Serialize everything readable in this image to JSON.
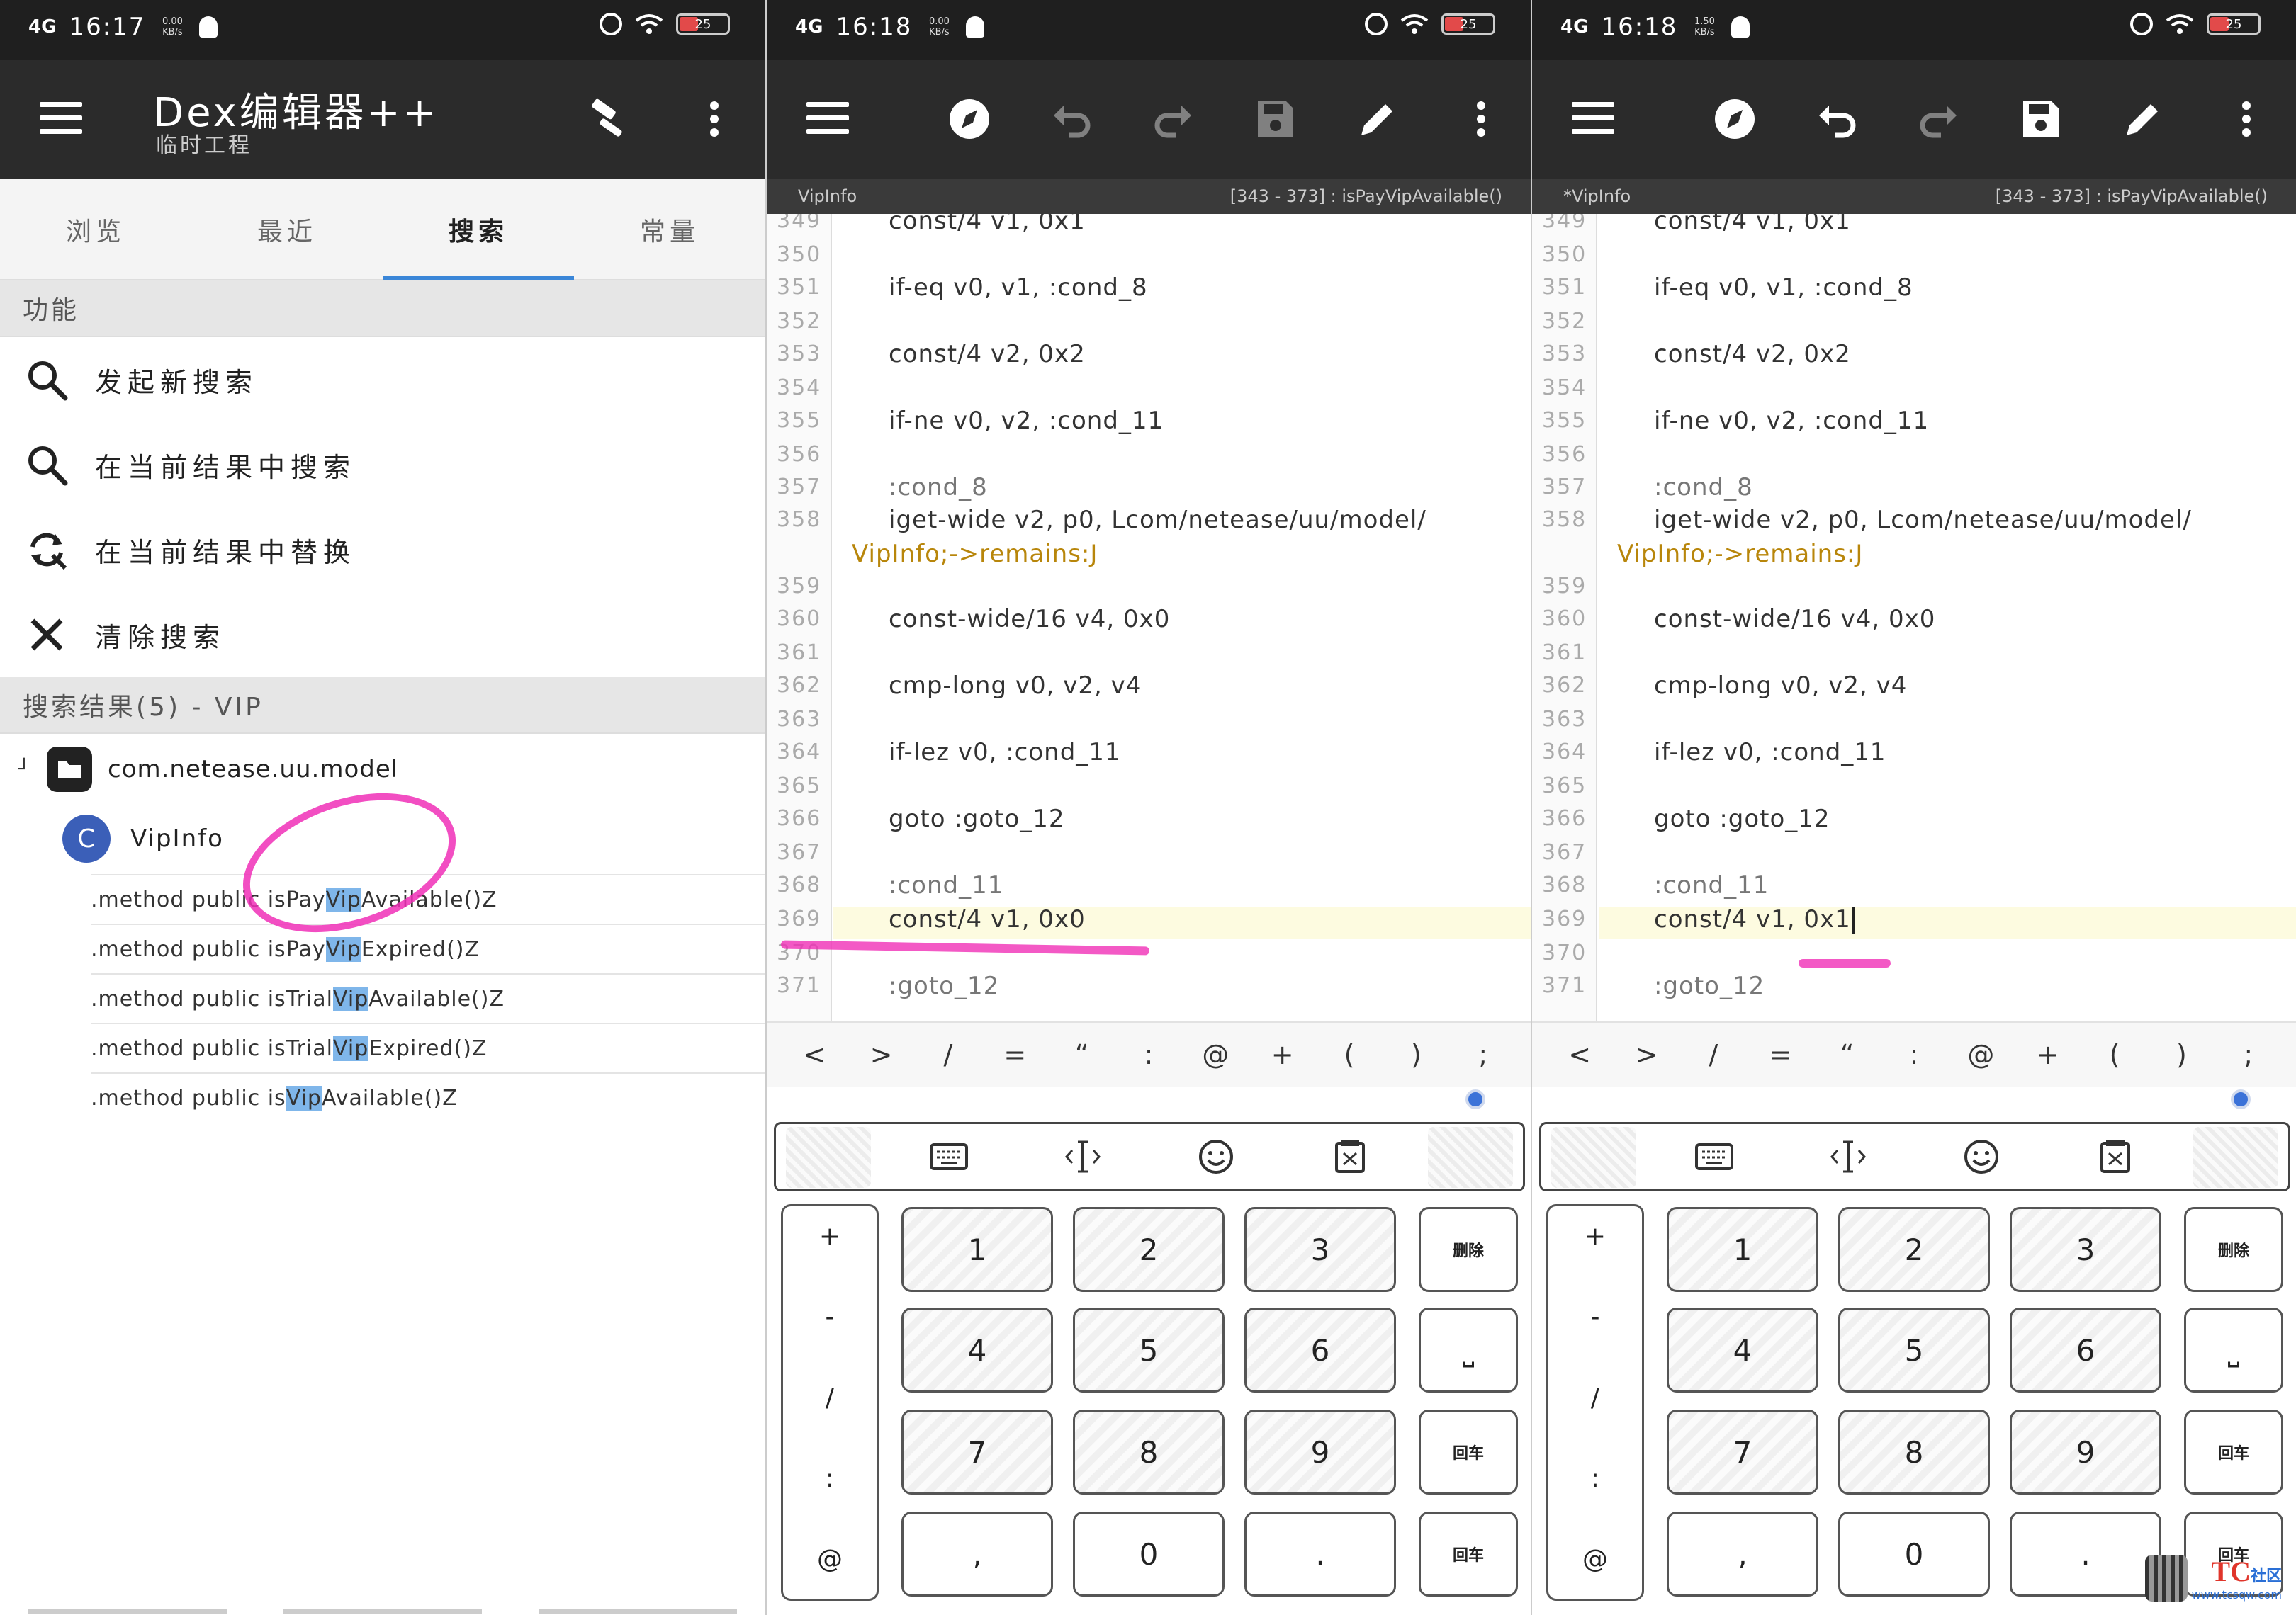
{
  "status": {
    "signal": "4G",
    "p1": {
      "time": "16:17",
      "speed": "0.00\nKB/s"
    },
    "p2": {
      "time": "16:18",
      "speed": "0.00\nKB/s"
    },
    "p3": {
      "time": "16:18",
      "speed": "1.50\nKB/s"
    },
    "battery": "25"
  },
  "browser": {
    "title": "Dex编辑器++",
    "subtitle": "临时工程",
    "tabs": [
      "浏览",
      "最近",
      "搜索",
      "常量"
    ],
    "active_tab": "搜索",
    "functions_header": "功能",
    "functions": [
      {
        "icon": "search-icon",
        "label": "发起新搜索"
      },
      {
        "icon": "search-icon",
        "label": "在当前结果中搜索"
      },
      {
        "icon": "replace-icon",
        "label": "在当前结果中替换"
      },
      {
        "icon": "close-icon",
        "label": "清除搜索"
      }
    ],
    "results_header": "搜索结果(5) - VIP",
    "tree": {
      "package": "com.netease.uu.model",
      "class_badge": "C",
      "class": "VipInfo",
      "methods": [
        {
          "pre": ".method public isPay",
          "hl": "Vip",
          "post": "Available()Z"
        },
        {
          "pre": ".method public isPay",
          "hl": "Vip",
          "post": "Expired()Z"
        },
        {
          "pre": ".method public isTrial",
          "hl": "Vip",
          "post": "Available()Z"
        },
        {
          "pre": ".method public isTrial",
          "hl": "Vip",
          "post": "Expired()Z"
        },
        {
          "pre": ".method public is",
          "hl": "Vip",
          "post": "Available()Z"
        }
      ]
    }
  },
  "editor": {
    "file_before": "VipInfo",
    "file_after": "*VipInfo",
    "location": "[343 - 373] : isPayVipAvailable()",
    "lines_before": [
      {
        "n": "349",
        "code": "const/4 v1, 0x1"
      },
      {
        "n": "350",
        "code": ""
      },
      {
        "n": "351",
        "code": "if-eq v0, v1, :cond_8"
      },
      {
        "n": "352",
        "code": ""
      },
      {
        "n": "353",
        "code": "const/4 v2, 0x2"
      },
      {
        "n": "354",
        "code": ""
      },
      {
        "n": "355",
        "code": "if-ne v0, v2, :cond_11"
      },
      {
        "n": "356",
        "code": ""
      },
      {
        "n": "357",
        "code": ":cond_8"
      },
      {
        "n": "358",
        "code": "iget-wide v2, p0, Lcom/netease/uu/model/"
      },
      {
        "n": "",
        "code": "VipInfo;->remains:J"
      },
      {
        "n": "359",
        "code": ""
      },
      {
        "n": "360",
        "code": "const-wide/16 v4, 0x0"
      },
      {
        "n": "361",
        "code": ""
      },
      {
        "n": "362",
        "code": "cmp-long v0, v2, v4"
      },
      {
        "n": "363",
        "code": ""
      },
      {
        "n": "364",
        "code": "if-lez v0, :cond_11"
      },
      {
        "n": "365",
        "code": ""
      },
      {
        "n": "366",
        "code": "goto :goto_12"
      },
      {
        "n": "367",
        "code": ""
      },
      {
        "n": "368",
        "code": ":cond_11"
      },
      {
        "n": "369",
        "code": "const/4 v1, 0x0"
      },
      {
        "n": "370",
        "code": ""
      },
      {
        "n": "371",
        "code": ":goto_12"
      }
    ],
    "line_369_after": "const/4 v1, 0x1",
    "symbols": [
      "<",
      ">",
      "/",
      "=",
      "“",
      ":",
      "@",
      "+",
      "(",
      ")",
      ";"
    ],
    "keys": {
      "side": [
        "+",
        "-",
        "/",
        ":",
        "@"
      ],
      "digits": [
        "1",
        "2",
        "3",
        "4",
        "5",
        "6",
        "7",
        "8",
        "9"
      ],
      "bottom": [
        ",",
        "0",
        "."
      ],
      "delete": "删除",
      "space": "⎵",
      "enter": "回车"
    }
  },
  "watermark": {
    "brand": "TC",
    "suffix": "社区",
    "url": "www.tcsqw.com"
  }
}
